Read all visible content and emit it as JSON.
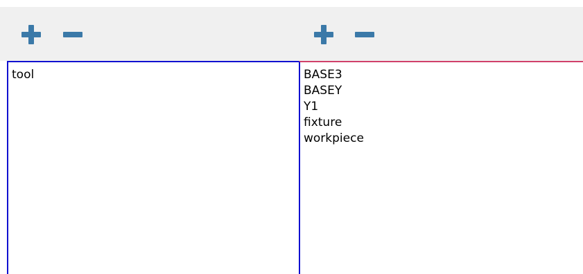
{
  "colors": {
    "toolbar_icon": "#3b79a8",
    "left_panel_border": "#1010d0",
    "right_panel_top_border": "#d0406a",
    "toolbar_background": "#f0f0f0"
  },
  "left": {
    "add_icon": "plus-icon",
    "remove_icon": "minus-icon",
    "items": [
      "tool"
    ]
  },
  "right": {
    "add_icon": "plus-icon",
    "remove_icon": "minus-icon",
    "items": [
      "BASE3",
      "BASEY",
      "Y1",
      "fixture",
      "workpiece"
    ]
  }
}
